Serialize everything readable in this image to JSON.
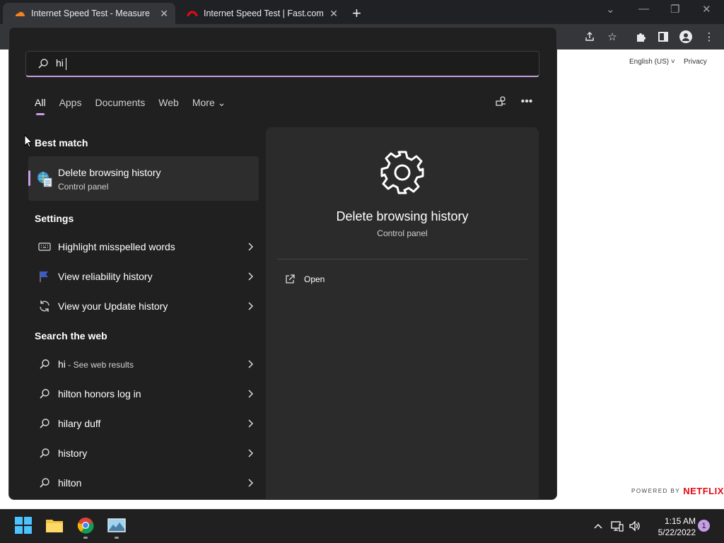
{
  "browser": {
    "tabs": [
      {
        "title": "Internet Speed Test - Measure N",
        "active": true
      },
      {
        "title": "Internet Speed Test | Fast.com",
        "active": false
      }
    ],
    "page": {
      "language": "English (US)",
      "privacy_link": "Privacy",
      "powered_by": "POWERED BY",
      "powered_brand": "NETFLIX"
    }
  },
  "search": {
    "query": "hi",
    "filters": [
      "All",
      "Apps",
      "Documents",
      "Web",
      "More"
    ],
    "selected_filter": "All",
    "best_match": {
      "heading": "Best match",
      "title": "Delete browsing history",
      "subtitle": "Control panel"
    },
    "settings": {
      "heading": "Settings",
      "items": [
        {
          "label": "Highlight misspelled words",
          "icon": "keyboard-icon"
        },
        {
          "label": "View reliability history",
          "icon": "flag-icon"
        },
        {
          "label": "View your Update history",
          "icon": "refresh-icon"
        }
      ]
    },
    "web": {
      "heading": "Search the web",
      "items": [
        {
          "label": "hi",
          "suffix": " - See web results"
        },
        {
          "label": "hilton honors log in",
          "suffix": ""
        },
        {
          "label": "hilary duff",
          "suffix": ""
        },
        {
          "label": "history",
          "suffix": ""
        },
        {
          "label": "hilton",
          "suffix": ""
        }
      ]
    },
    "detail": {
      "title": "Delete browsing history",
      "subtitle": "Control panel",
      "actions": [
        {
          "label": "Open",
          "icon": "open-external-icon"
        }
      ]
    }
  },
  "taskbar": {
    "time": "1:15 AM",
    "date": "5/22/2022",
    "notification_count": "1"
  },
  "colors": {
    "accent": "#c79ee6",
    "panel_bg": "#202020",
    "detail_bg": "#2b2b2b",
    "netflix_red": "#e50914"
  }
}
